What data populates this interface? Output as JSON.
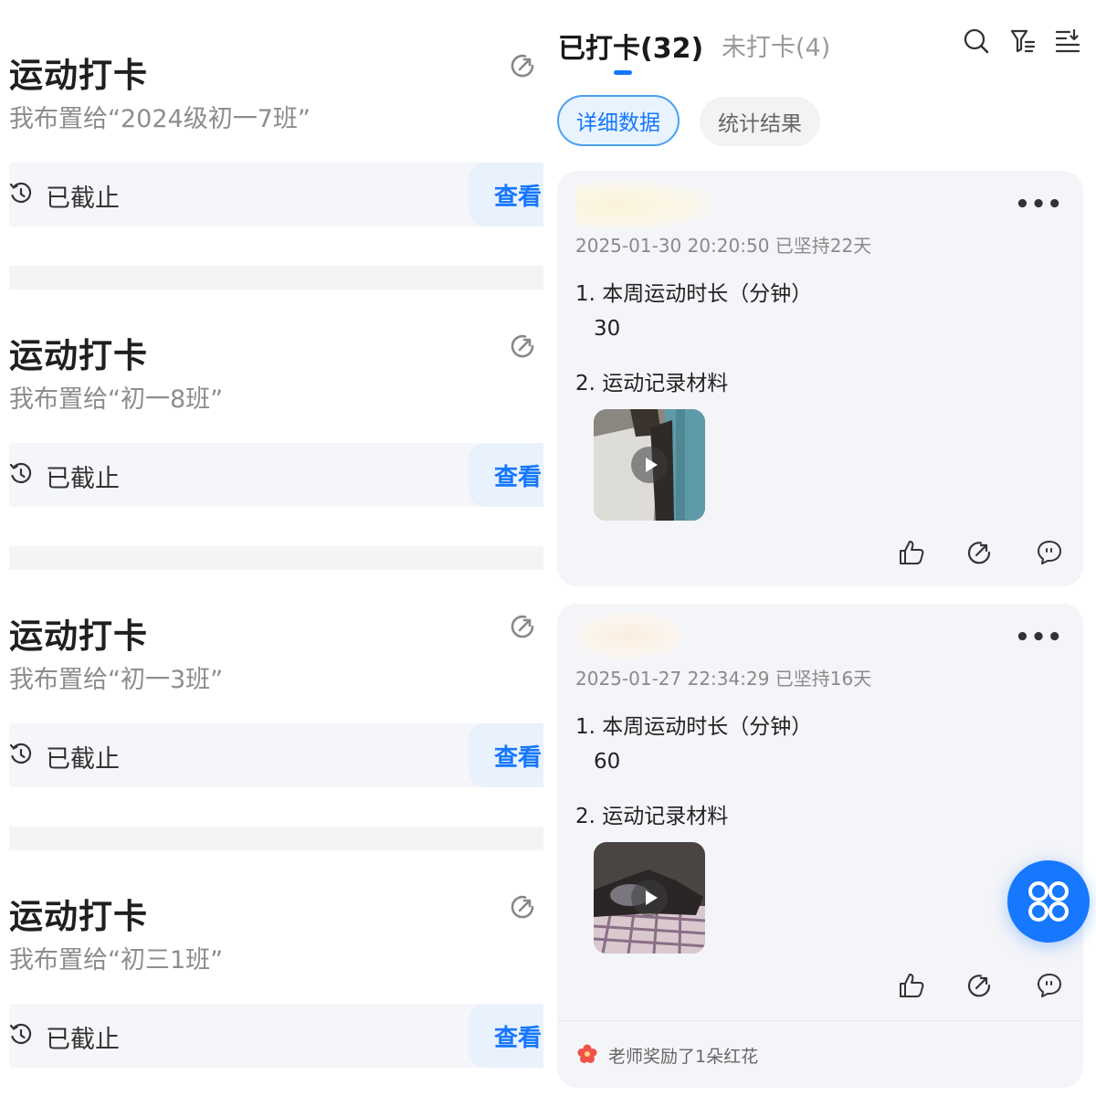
{
  "tasks": [
    {
      "title": "运动打卡",
      "subtitle": "我布置给“2024级初一7班”",
      "status": "已截止",
      "view": "查看"
    },
    {
      "title": "运动打卡",
      "subtitle": "我布置给“初一8班”",
      "status": "已截止",
      "view": "查看"
    },
    {
      "title": "运动打卡",
      "subtitle": "我布置给“初一3班”",
      "status": "已截止",
      "view": "查看"
    },
    {
      "title": "运动打卡",
      "subtitle": "我布置给“初三1班”",
      "status": "已截止",
      "view": "查看"
    }
  ],
  "tabs": {
    "done": "已打卡(32)",
    "undone": "未打卡(4)"
  },
  "segments": {
    "detail": "详细数据",
    "stats": "统计结果"
  },
  "header_icons": [
    "search-icon",
    "filter-icon",
    "sort-icon"
  ],
  "records": [
    {
      "meta": "2025-01-30 20:20:50 已坚持22天",
      "q1": "1. 本周运动时长（分钟）",
      "a1": "30",
      "q2": "2. 运动记录材料",
      "more": "•••"
    },
    {
      "meta": "2025-01-27 22:34:29 已坚持16天",
      "q1": "1. 本周运动时长（分钟）",
      "a1": "60",
      "q2": "2. 运动记录材料",
      "more": "•••",
      "award": "老师奖励了1朵红花"
    }
  ],
  "colors": {
    "accent": "#1677ff",
    "muted": "#8d8d8d",
    "card_bg": "#f4f5f8",
    "award_flower": "#f0524a"
  }
}
